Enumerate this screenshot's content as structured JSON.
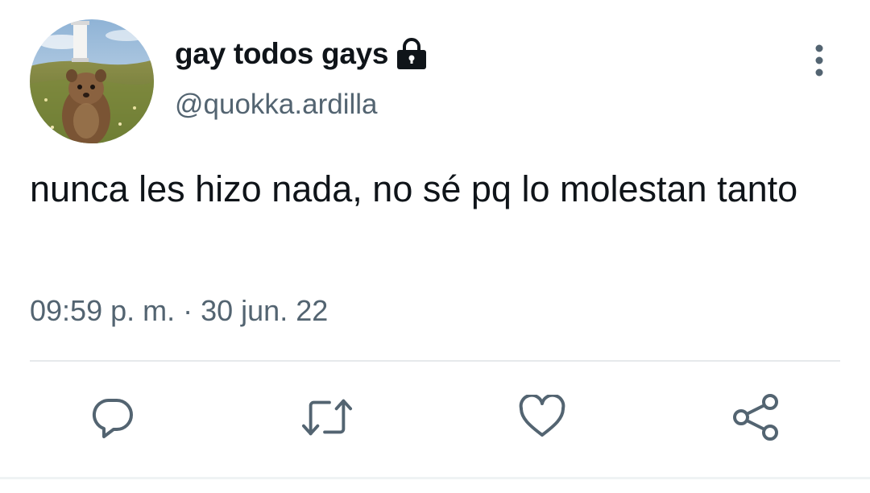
{
  "author": {
    "display_name": "gay todos gays",
    "handle": "@quokka.ardilla",
    "protected_icon": "lock-icon",
    "avatar_icon": "quokka-photo"
  },
  "tweet": {
    "text": "nunca les hizo nada, no sé pq lo molestan tanto",
    "time": "09:59 p. m.",
    "separator": "·",
    "date": "30 jun. 22"
  },
  "menu": {
    "icon": "more-vertical-icon"
  },
  "actions": [
    {
      "name": "reply",
      "icon": "reply-icon"
    },
    {
      "name": "retweet",
      "icon": "retweet-icon"
    },
    {
      "name": "like",
      "icon": "heart-icon"
    },
    {
      "name": "share",
      "icon": "share-icon"
    }
  ],
  "colors": {
    "primary_text": "#0f1419",
    "secondary_text": "#536471",
    "icon": "#536471",
    "divider": "#e6e9eb"
  }
}
